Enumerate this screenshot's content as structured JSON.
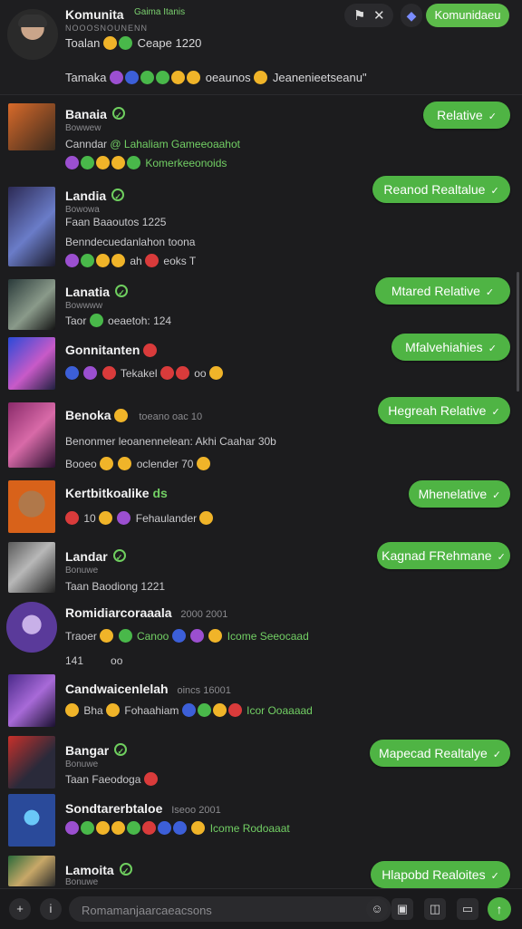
{
  "header": {
    "title": "Komunita",
    "title_tag": "Gaima Itanis",
    "subtitle": "NOOOSNOUNENN",
    "line1_text": "Toalan",
    "line1_count": "Ceape 1220",
    "line2_text": "Tamaka",
    "line2_suffix": "oeaunos",
    "line2_note": "Jeanenieetseanu\"",
    "action_button": "Komunidaeu",
    "tool_icons": [
      "flag-icon",
      "tools-icon"
    ],
    "shield_icon": "shield-icon"
  },
  "rows": [
    {
      "name": "Banaia",
      "sub": "Bowwew",
      "line1": "Canndar",
      "line1_green": "@ Lahaliam Gameeoaahot",
      "line2_green": "Komerkeeonoids",
      "button": "Relative",
      "verified": true
    },
    {
      "name": "Landia",
      "sub": "Bowowa",
      "line1": "Faan Baaoutos 1225",
      "line2": "Benndecuedanlahon  toona",
      "line3": "ah",
      "line3_tail": "eoks T",
      "button": "Reanod Realtalue",
      "verified": true
    },
    {
      "name": "Lanatia",
      "sub": "Bowwww",
      "line1": "Taor",
      "line1_tail": "oeaetoh: 124",
      "button": "Mtared Relative",
      "verified": true
    },
    {
      "name": "Gonnitanten",
      "line1": "Tekakel",
      "line1_tail": "oo",
      "button": "Mfalvehiahies"
    },
    {
      "name": "Benoka",
      "name_tail": "toeano  oac 10",
      "line1": "Benonmer  leoanennelean: Akhi Caahar 30b",
      "line2": "Booeo",
      "line2_tail": "oclender 70",
      "button": "Hegreah Relative"
    },
    {
      "name": "Kertbitkoalike",
      "name_tail": "ds",
      "line1": "10",
      "line1_tail": "Fehaulander",
      "button": "Mhenelative"
    },
    {
      "name": "Landar",
      "sub": "Bonuwe",
      "line1": "Taan Baodiong 1221",
      "button": "Kagnad FRehmane",
      "verified": true
    },
    {
      "name": "Romidiarcoraaala",
      "name_tail": "2000 2001",
      "line1": "Traoer",
      "line1_green": "Canoo",
      "line1_tail_green": "Icome Seeocaad",
      "line2": "141",
      "line2_tail": "oo",
      "button": ""
    },
    {
      "name": "Candwaicenlelah",
      "name_tail": "oincs 16001",
      "line1": "Bha",
      "line1_mid": "Fohaahiam",
      "line1_green": "Icor Ooaaaad",
      "button": ""
    },
    {
      "name": "Bangar",
      "sub": "Bonuwe",
      "line1": "Taan Faeodoga",
      "button": "Mapecad Realtalye",
      "verified": true
    },
    {
      "name": "Sondtarerbtaloe",
      "name_tail": "Iseoo 2001",
      "line1_green": "Icome Rodoaaat",
      "button": ""
    },
    {
      "name": "Lamoita",
      "sub": "Bonuwe",
      "button": "Hlapobd Realoites",
      "verified": true
    }
  ],
  "composer": {
    "placeholder": "Romamanjaarcaeacsons",
    "left_icons": [
      "add-icon",
      "info-icon"
    ],
    "right_icons": [
      "emoji-icon",
      "image-icon",
      "camera-icon",
      "card-icon",
      "send-icon"
    ]
  },
  "colors": {
    "accent": "#4fb444",
    "background": "#1c1c1e",
    "text": "#e9e9ea",
    "muted": "#8c8c90"
  }
}
